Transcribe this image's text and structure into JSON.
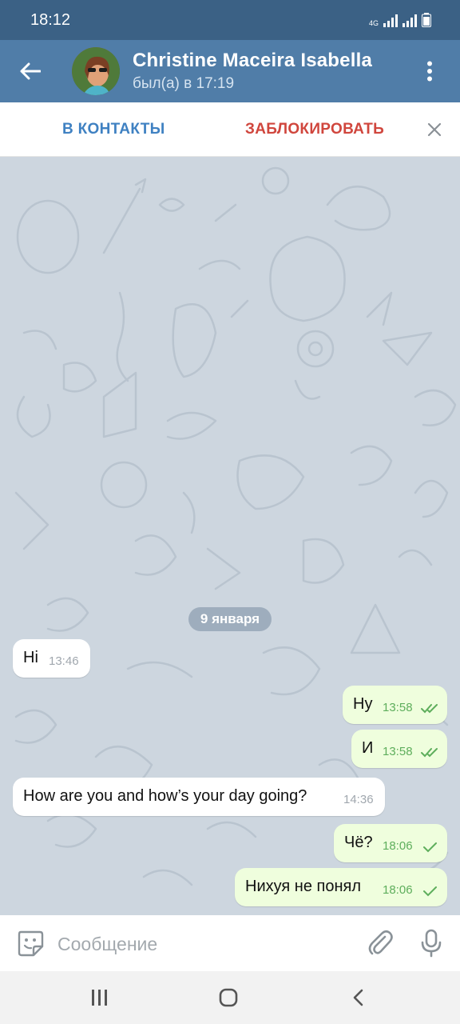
{
  "status_bar": {
    "time": "18:12",
    "network": "4G",
    "icons": [
      "network-4g-icon",
      "signal-icon",
      "signal-icon",
      "battery-icon"
    ]
  },
  "header": {
    "contact_name": "Christine Maceira Isabella",
    "last_seen": "был(а) в 17:19",
    "icons": [
      "back-arrow-icon",
      "avatar",
      "more-vert-icon"
    ]
  },
  "action_bar": {
    "add_contact": "В КОНТАКТЫ",
    "block": "ЗАБЛОКИРОВАТЬ",
    "close_icon": "close-icon"
  },
  "chat": {
    "date_separator": "9 января",
    "messages": [
      {
        "direction": "in",
        "text": "Hi",
        "time": "13:46"
      },
      {
        "direction": "out",
        "text": "Ну",
        "time": "13:58",
        "status": "read"
      },
      {
        "direction": "out",
        "text": "И",
        "time": "13:58",
        "status": "read"
      },
      {
        "direction": "in",
        "text": "How are you and how’s your day going?",
        "time": "14:36"
      },
      {
        "direction": "out",
        "text": "Чё?",
        "time": "18:06",
        "status": "sent"
      },
      {
        "direction": "out",
        "text": "Нихуя не понял",
        "time": "18:06",
        "status": "sent"
      }
    ]
  },
  "input_bar": {
    "placeholder": "Сообщение",
    "value": "",
    "icons": [
      "emoji-sticker-icon",
      "paperclip-icon",
      "microphone-icon"
    ]
  },
  "nav_bar": {
    "icons": [
      "recents-icon",
      "home-icon",
      "back-icon"
    ]
  },
  "colors": {
    "status_bar": "#3b6185",
    "header": "#507da8",
    "chat_background": "#cdd6df",
    "incoming_bubble": "#ffffff",
    "outgoing_bubble": "#effedd",
    "add_contact_text": "#3f81c2",
    "block_text": "#d0463d",
    "tick_color": "#5eae5c"
  }
}
